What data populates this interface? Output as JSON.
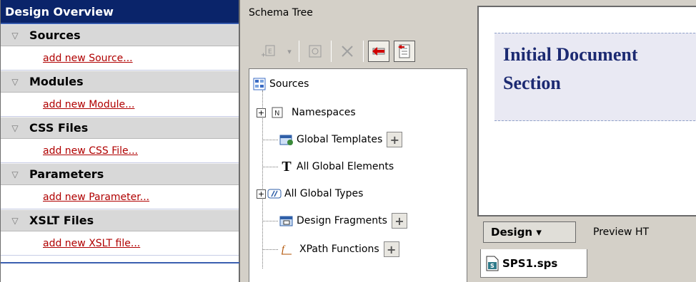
{
  "overview": {
    "title": "Design Overview",
    "sections": [
      {
        "label": "Sources",
        "link": "add new Source..."
      },
      {
        "label": "Modules",
        "link": "add new Module..."
      },
      {
        "label": "CSS Files",
        "link": "add new CSS File..."
      },
      {
        "label": "Parameters",
        "link": "add new Parameter..."
      },
      {
        "label": "XSLT Files",
        "link": "add new XSLT file..."
      }
    ],
    "link_color": "#b00000",
    "header_color": "#0a246a"
  },
  "schema": {
    "title": "Schema Tree",
    "toolbar": [
      "add-element-icon",
      "dropdown-icon",
      "properties-icon",
      "delete-icon",
      "left-arrow-icon",
      "list-icon"
    ],
    "tree": {
      "root": "Sources",
      "items": [
        {
          "label": "Namespaces"
        },
        {
          "label": "Global Templates"
        },
        {
          "label": "All Global Elements"
        },
        {
          "label": "All Global Types"
        },
        {
          "label": "Design Fragments"
        },
        {
          "label": "XPath Functions"
        }
      ]
    }
  },
  "design": {
    "doc_title_line1": "Initial Document",
    "doc_title_line2": "Section",
    "modes": {
      "design": "Design ▾",
      "preview": "Preview HT"
    },
    "file_tab": "SPS1.sps"
  }
}
